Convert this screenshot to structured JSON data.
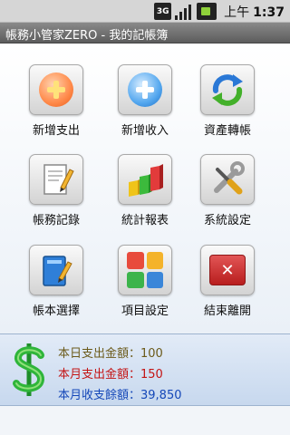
{
  "status_bar": {
    "network": "3G",
    "ampm": "上午",
    "time": "1:37",
    "icons": [
      "network-3g-icon",
      "signal-icon",
      "battery-icon"
    ]
  },
  "title_bar": {
    "title": "帳務小管家ZERO - 我的記帳簿"
  },
  "menu": [
    {
      "label": "新增支出",
      "icon": "add-expense-icon"
    },
    {
      "label": "新增收入",
      "icon": "add-income-icon"
    },
    {
      "label": "資產轉帳",
      "icon": "transfer-icon"
    },
    {
      "label": "帳務記錄",
      "icon": "records-icon"
    },
    {
      "label": "統計報表",
      "icon": "chart-icon"
    },
    {
      "label": "系統設定",
      "icon": "tools-icon"
    },
    {
      "label": "帳本選擇",
      "icon": "book-icon"
    },
    {
      "label": "項目設定",
      "icon": "category-grid-icon"
    },
    {
      "label": "結束離開",
      "icon": "exit-icon"
    }
  ],
  "summary": {
    "today_expense": "本日支出金額：100",
    "month_expense": "本月支出金額：150",
    "month_balance": "本月收支餘額：39,850",
    "colors": {
      "today": "#6b5a1a",
      "month_expense": "#c41414",
      "balance": "#1447b8"
    }
  }
}
